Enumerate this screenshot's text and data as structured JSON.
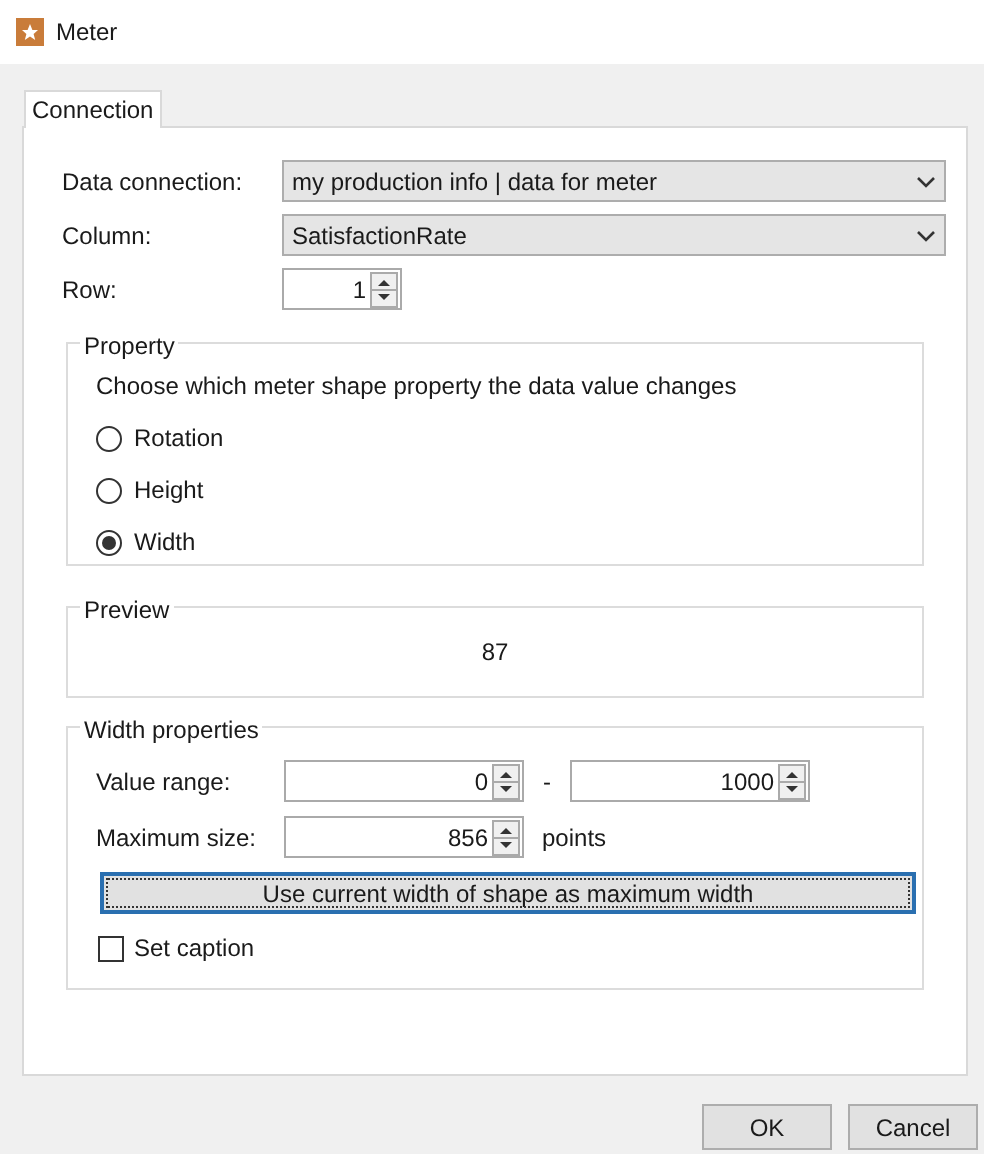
{
  "window": {
    "title": "Meter"
  },
  "tabs": [
    {
      "label": "Connection",
      "selected": true
    }
  ],
  "connection": {
    "data_connection": {
      "label": "Data connection:",
      "value": "my production info | data for meter"
    },
    "column": {
      "label": "Column:",
      "value": "SatisfactionRate"
    },
    "row": {
      "label": "Row:",
      "value": "1"
    }
  },
  "property": {
    "title": "Property",
    "description": "Choose which meter shape property the data value changes",
    "options": [
      {
        "label": "Rotation",
        "selected": false
      },
      {
        "label": "Height",
        "selected": false
      },
      {
        "label": "Width",
        "selected": true
      }
    ]
  },
  "preview": {
    "title": "Preview",
    "value": "87"
  },
  "width_properties": {
    "title": "Width properties",
    "value_range": {
      "label": "Value range:",
      "min": "0",
      "separator": "-",
      "max": "1000"
    },
    "maximum_size": {
      "label": "Maximum size:",
      "value": "856",
      "unit": "points"
    },
    "use_current_button": "Use current width of shape as maximum width",
    "set_caption": {
      "label": "Set caption",
      "checked": false
    }
  },
  "buttons": [
    "OK",
    "Cancel"
  ]
}
